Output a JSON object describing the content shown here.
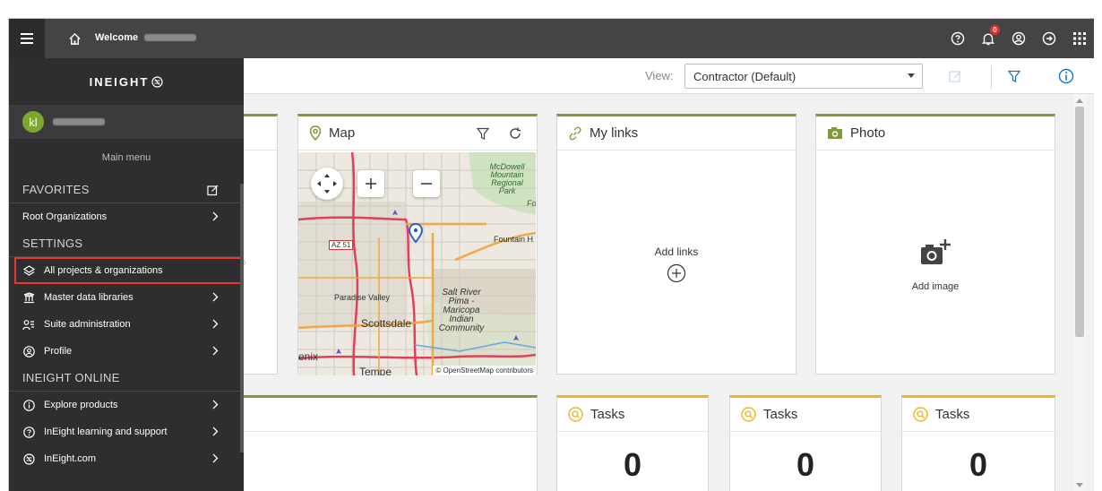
{
  "topbar": {
    "welcome_label": "Welcome",
    "notification_count": "0",
    "icons": [
      "hamburger-icon",
      "home-icon",
      "help-icon",
      "bell-icon",
      "account-icon",
      "logout-icon",
      "apps-grid-icon"
    ]
  },
  "sidebar": {
    "brand": "INEIGHT",
    "avatar_initials": "kl",
    "main_menu_label": "Main menu",
    "favorites_label": "FAVORITES",
    "favorites_items": [
      {
        "label": "Root Organizations",
        "icon": "none"
      }
    ],
    "settings_label": "SETTINGS",
    "settings_items": [
      {
        "label": "All projects & organizations",
        "icon": "layers-icon",
        "selected": true
      },
      {
        "label": "Master data libraries",
        "icon": "library-icon"
      },
      {
        "label": "Suite administration",
        "icon": "users-admin-icon"
      },
      {
        "label": "Profile",
        "icon": "profile-icon"
      }
    ],
    "online_label": "INEIGHT ONLINE",
    "online_items": [
      {
        "label": "Explore products",
        "icon": "info-icon"
      },
      {
        "label": "InEight learning and support",
        "icon": "help-icon"
      },
      {
        "label": "InEight.com",
        "icon": "ineight-logo-icon"
      }
    ]
  },
  "viewbar": {
    "view_label": "View:",
    "selected_view": "Contractor (Default)"
  },
  "cards": {
    "map": {
      "title": "Map",
      "labels": {
        "mcdowell": "McDowell Mountain Regional Park",
        "fountain": "Fountain H",
        "az51": "AZ 51",
        "paradise": "Paradise Valley",
        "saltriver": "Salt River Pima - Maricopa Indian Community",
        "scottsdale": "Scottsdale",
        "phoenix": "enix",
        "tempe": "Tempe",
        "for": "For"
      },
      "attribution": "© OpenStreetMap contributors"
    },
    "links": {
      "title": "My links",
      "add_label": "Add links"
    },
    "photo": {
      "title": "Photo",
      "add_label": "Add image"
    },
    "tasks": [
      {
        "title": "Tasks",
        "count": "0"
      },
      {
        "title": "Tasks",
        "count": "0"
      },
      {
        "title": "Tasks",
        "count": "0"
      }
    ]
  },
  "colors": {
    "accent_green": "#7e9a3a",
    "accent_yellow": "#eeb420",
    "highlight_red": "#e8382f",
    "info_blue": "#1a73c8"
  }
}
